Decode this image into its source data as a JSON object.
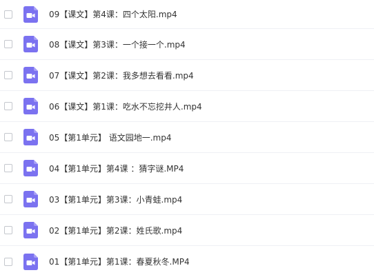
{
  "colors": {
    "icon_bg": "#7b72f0",
    "icon_fold": "#a79ff6",
    "text": "#333333",
    "divider": "#eef0f4"
  },
  "files": [
    {
      "name": "09【课文】第4课：四个太阳.mp4",
      "icon": "video-file-icon"
    },
    {
      "name": "08【课文】第3课：一个接一个.mp4",
      "icon": "video-file-icon"
    },
    {
      "name": "07【课文】第2课：我多想去看看.mp4",
      "icon": "video-file-icon"
    },
    {
      "name": "06【课文】第1课：吃水不忘挖井人.mp4",
      "icon": "video-file-icon"
    },
    {
      "name": "05【第1单元】 语文园地一.mp4",
      "icon": "video-file-icon"
    },
    {
      "name": "04【第1单元】第4课 ：猜字谜.MP4",
      "icon": "video-file-icon"
    },
    {
      "name": "03【第1单元】第3课：小青蛙.mp4",
      "icon": "video-file-icon"
    },
    {
      "name": "02【第1单元】第2课：姓氏歌.mp4",
      "icon": "video-file-icon"
    },
    {
      "name": "01【第1单元】第1课：春夏秋冬.MP4",
      "icon": "video-file-icon"
    }
  ]
}
